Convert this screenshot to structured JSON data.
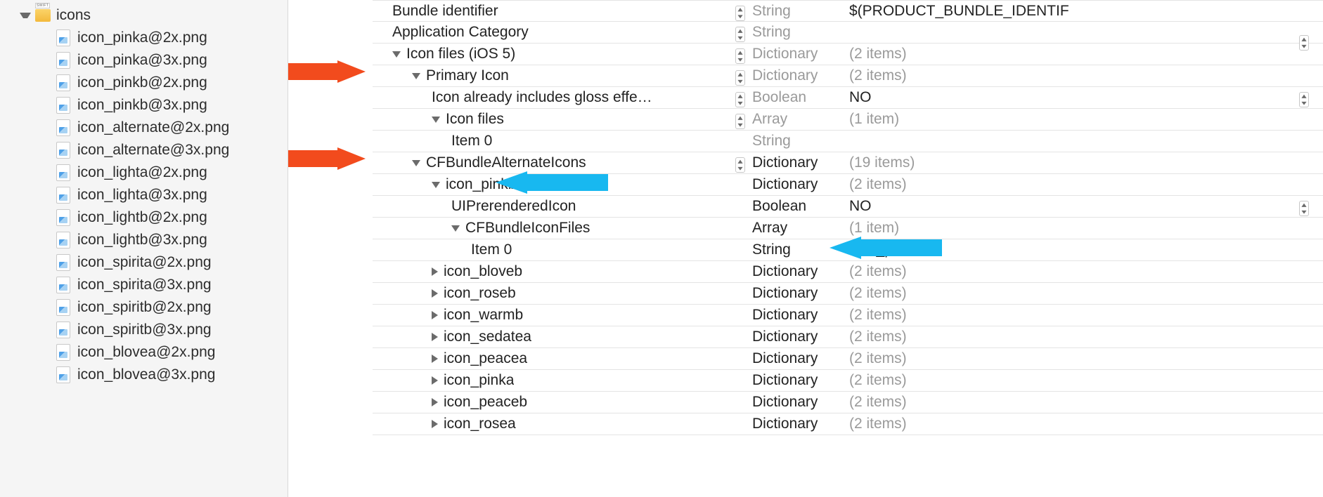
{
  "sidebar": {
    "folder": "icons",
    "files": [
      "icon_pinka@2x.png",
      "icon_pinka@3x.png",
      "icon_pinkb@2x.png",
      "icon_pinkb@3x.png",
      "icon_alternate@2x.png",
      "icon_alternate@3x.png",
      "icon_lighta@2x.png",
      "icon_lighta@3x.png",
      "icon_lightb@2x.png",
      "icon_lightb@3x.png",
      "icon_spirita@2x.png",
      "icon_spirita@3x.png",
      "icon_spiritb@2x.png",
      "icon_spiritb@3x.png",
      "icon_blovea@2x.png",
      "icon_blovea@3x.png"
    ]
  },
  "plist": [
    {
      "indent": 1,
      "tri": "",
      "key": "Bundle identifier",
      "type": "String",
      "typeGray": true,
      "value": "$(PRODUCT_BUNDLE_IDENTIF",
      "valueGray": false,
      "stepperKey": true
    },
    {
      "indent": 1,
      "tri": "",
      "key": "Application Category",
      "type": "String",
      "typeGray": true,
      "value": "",
      "valueGray": false,
      "stepperKey": true,
      "stepperVal": true
    },
    {
      "indent": 1,
      "tri": "down",
      "key": "Icon files (iOS 5)",
      "type": "Dictionary",
      "typeGray": true,
      "value": "(2 items)",
      "valueGray": true,
      "stepperKey": true
    },
    {
      "indent": 2,
      "tri": "down",
      "key": "Primary Icon",
      "type": "Dictionary",
      "typeGray": true,
      "value": "(2 items)",
      "valueGray": true,
      "stepperKey": true
    },
    {
      "indent": 3,
      "tri": "",
      "key": "Icon already includes gloss effe…",
      "type": "Boolean",
      "typeGray": true,
      "value": "NO",
      "valueGray": false,
      "stepperKey": true,
      "stepperVal": true
    },
    {
      "indent": 3,
      "tri": "down",
      "key": "Icon files",
      "type": "Array",
      "typeGray": true,
      "value": "(1 item)",
      "valueGray": true,
      "stepperKey": true
    },
    {
      "indent": 4,
      "tri": "",
      "key": "Item 0",
      "type": "String",
      "typeGray": true,
      "value": "",
      "valueGray": false
    },
    {
      "indent": 2,
      "tri": "down",
      "key": "CFBundleAlternateIcons",
      "type": "Dictionary",
      "typeGray": false,
      "value": "(19 items)",
      "valueGray": true,
      "stepperKey": true
    },
    {
      "indent": 3,
      "tri": "down",
      "key": "icon_pinkb",
      "type": "Dictionary",
      "typeGray": false,
      "value": "(2 items)",
      "valueGray": true
    },
    {
      "indent": 4,
      "tri": "",
      "key": "UIPrerenderedIcon",
      "type": "Boolean",
      "typeGray": false,
      "value": "NO",
      "valueGray": false,
      "stepperVal": true
    },
    {
      "indent": 4,
      "tri": "down",
      "key": "CFBundleIconFiles",
      "type": "Array",
      "typeGray": false,
      "value": "(1 item)",
      "valueGray": true
    },
    {
      "indent": 5,
      "tri": "",
      "key": "Item 0",
      "type": "String",
      "typeGray": false,
      "value": "icon_pinkb",
      "valueGray": false
    },
    {
      "indent": 3,
      "tri": "right",
      "key": "icon_bloveb",
      "type": "Dictionary",
      "typeGray": false,
      "value": "(2 items)",
      "valueGray": true
    },
    {
      "indent": 3,
      "tri": "right",
      "key": "icon_roseb",
      "type": "Dictionary",
      "typeGray": false,
      "value": "(2 items)",
      "valueGray": true
    },
    {
      "indent": 3,
      "tri": "right",
      "key": "icon_warmb",
      "type": "Dictionary",
      "typeGray": false,
      "value": "(2 items)",
      "valueGray": true
    },
    {
      "indent": 3,
      "tri": "right",
      "key": "icon_sedatea",
      "type": "Dictionary",
      "typeGray": false,
      "value": "(2 items)",
      "valueGray": true
    },
    {
      "indent": 3,
      "tri": "right",
      "key": "icon_peacea",
      "type": "Dictionary",
      "typeGray": false,
      "value": "(2 items)",
      "valueGray": true
    },
    {
      "indent": 3,
      "tri": "right",
      "key": "icon_pinka",
      "type": "Dictionary",
      "typeGray": false,
      "value": "(2 items)",
      "valueGray": true
    },
    {
      "indent": 3,
      "tri": "right",
      "key": "icon_peaceb",
      "type": "Dictionary",
      "typeGray": false,
      "value": "(2 items)",
      "valueGray": true
    },
    {
      "indent": 3,
      "tri": "right",
      "key": "icon_rosea",
      "type": "Dictionary",
      "typeGray": false,
      "value": "(2 items)",
      "valueGray": true
    }
  ],
  "annotations": {
    "arrow_red_1": {
      "color": "#f24b1d"
    },
    "arrow_red_2": {
      "color": "#f24b1d"
    },
    "arrow_cyan_1": {
      "color": "#18b8f0"
    },
    "arrow_cyan_2": {
      "color": "#18b8f0"
    }
  }
}
